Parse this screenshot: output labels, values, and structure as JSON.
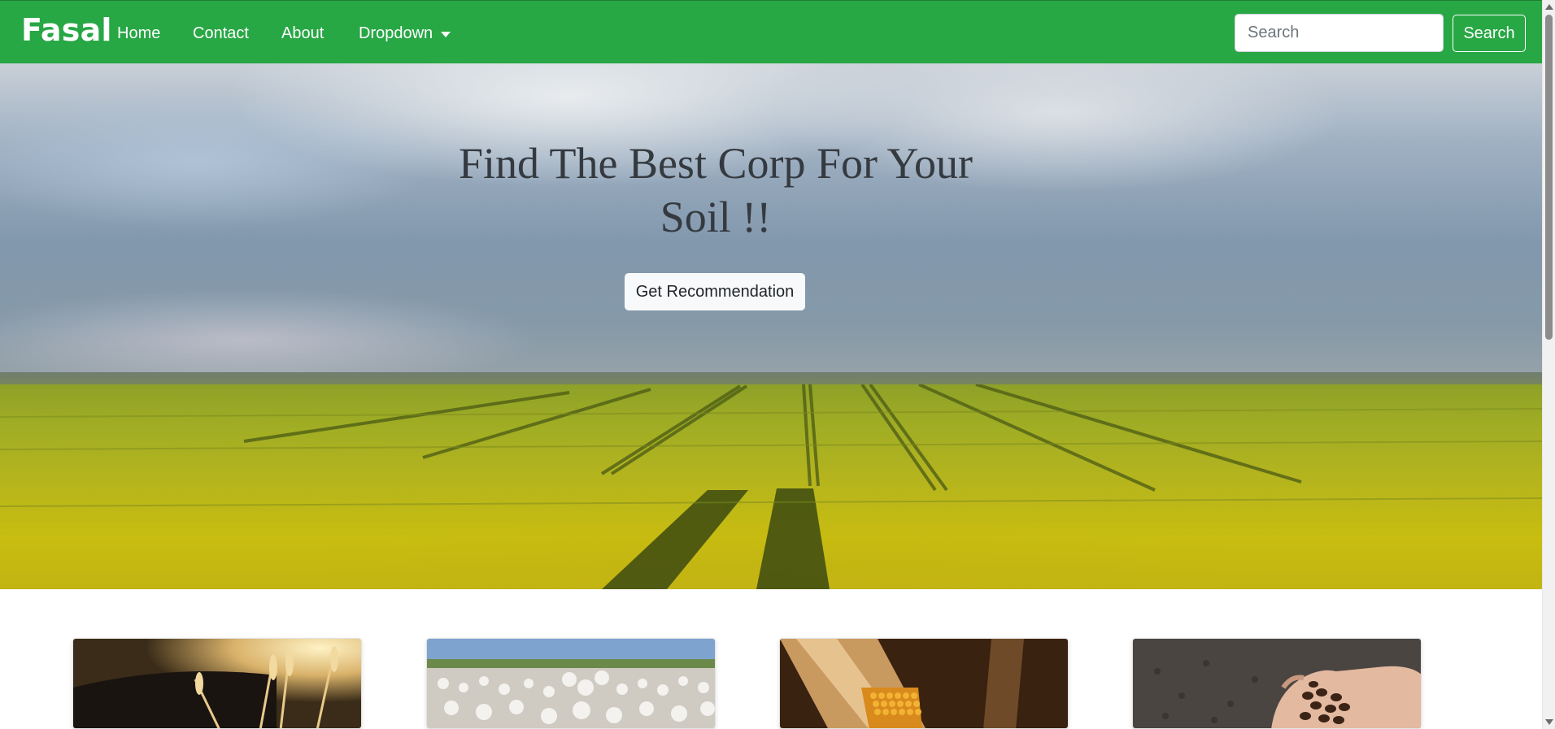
{
  "navbar": {
    "brand": "Fasal",
    "links": {
      "home": "Home",
      "contact": "Contact",
      "about": "About",
      "dropdown": "Dropdown"
    },
    "search": {
      "placeholder": "Search",
      "value": "",
      "button_label": "Search"
    },
    "background_color": "#28a745"
  },
  "hero": {
    "title": "Find The Best Corp For Your Soil !!",
    "cta_label": "Get Recommendation",
    "title_color": "#343a40"
  },
  "cards": [
    {
      "image": "wheat-image"
    },
    {
      "image": "cotton-image"
    },
    {
      "image": "corn-image"
    },
    {
      "image": "coffee-beans-image"
    }
  ]
}
